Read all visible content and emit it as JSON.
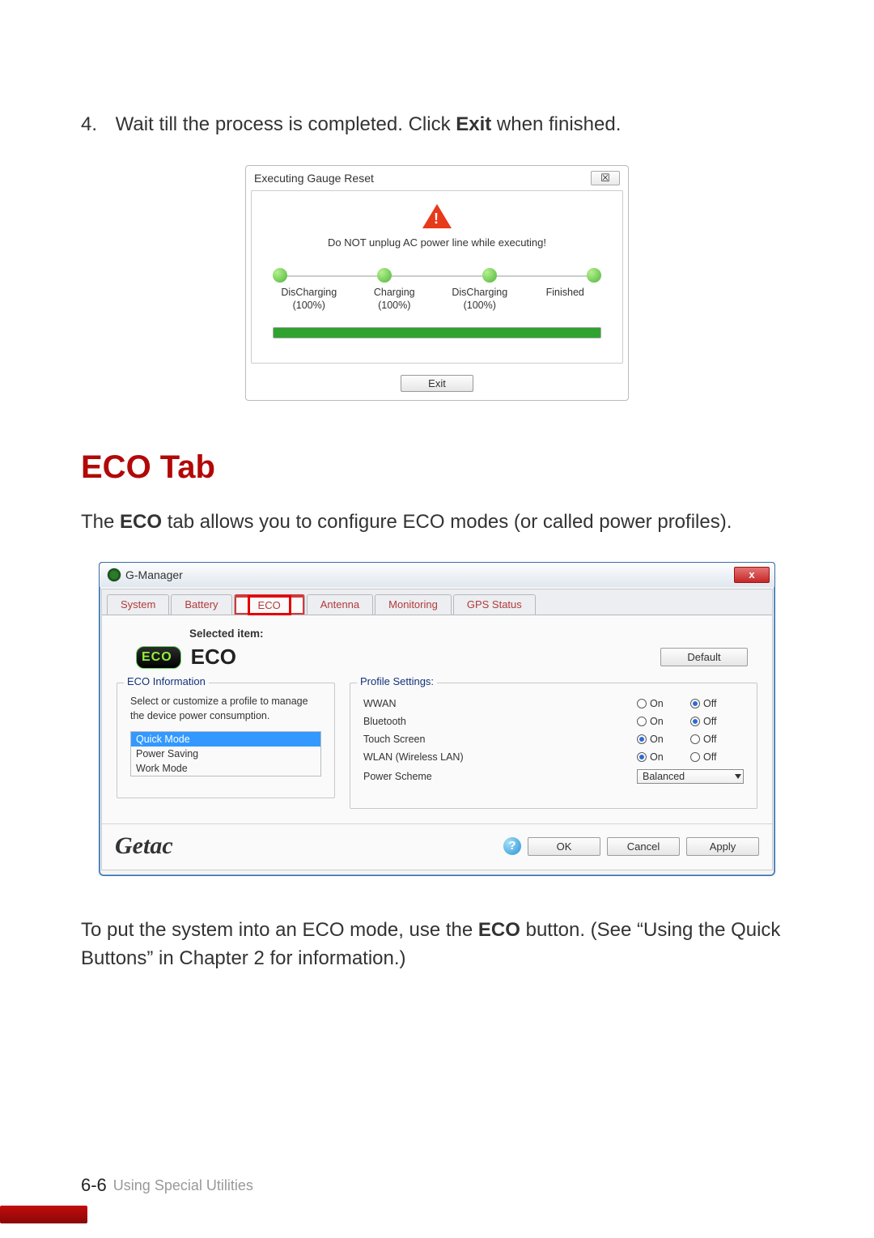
{
  "step": {
    "number": "4.",
    "text_before": "Wait till the process is completed. Click ",
    "bold": "Exit",
    "text_after": " when finished."
  },
  "dialog1": {
    "title": "Executing Gauge Reset",
    "close_glyph": "☒",
    "message": "Do NOT unplug AC power line while executing!",
    "nodes": [
      {
        "line1": "DisCharging",
        "line2": "(100%)"
      },
      {
        "line1": "Charging",
        "line2": "(100%)"
      },
      {
        "line1": "DisCharging",
        "line2": "(100%)"
      },
      {
        "line1": "Finished",
        "line2": ""
      }
    ],
    "exit_label": "Exit"
  },
  "heading": "ECO Tab",
  "para1": {
    "before": "The ",
    "bold": "ECO",
    "after": " tab allows you to configure ECO modes (or called power profiles)."
  },
  "dialog2": {
    "appname": "G-Manager",
    "close_glyph": "x",
    "tabs": [
      "System",
      "Battery",
      "ECO",
      "Antenna",
      "Monitoring",
      "GPS Status"
    ],
    "active_tab_index": 2,
    "selected_label": "Selected item:",
    "eco_badge": "ECO",
    "selected_name": "ECO",
    "default_label": "Default",
    "left_fieldset": {
      "legend": "ECO Information",
      "desc": "Select or customize a profile to manage the device power consumption.",
      "modes": [
        "Quick Mode",
        "Power Saving",
        "Work Mode"
      ],
      "active_mode_index": 0
    },
    "right_fieldset": {
      "legend": "Profile Settings:",
      "rows": [
        {
          "label": "WWAN",
          "value": "Off"
        },
        {
          "label": "Bluetooth",
          "value": "Off"
        },
        {
          "label": "Touch Screen",
          "value": "On"
        },
        {
          "label": "WLAN (Wireless LAN)",
          "value": "On"
        }
      ],
      "on_label": "On",
      "off_label": "Off",
      "scheme_label": "Power Scheme",
      "scheme_value": "Balanced"
    },
    "brand": "Getac",
    "help_glyph": "?",
    "ok_label": "OK",
    "cancel_label": "Cancel",
    "apply_label": "Apply"
  },
  "para2": {
    "seg1": "To put the system into an ECO mode, use the ",
    "bold": "ECO",
    "seg2": " button. (See “Using the Quick Buttons” in Chapter 2 for information.)"
  },
  "footer": {
    "page": "6-6",
    "chapter": "Using Special Utilities"
  }
}
